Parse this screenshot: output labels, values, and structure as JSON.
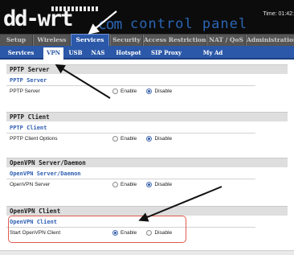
{
  "header": {
    "logo_main": "dd-wrt",
    "logo_com": ".com",
    "logo_tagline": "control panel",
    "time_label": "Time: 01:42:"
  },
  "main_tabs": [
    "Setup",
    "Wireless",
    "Services",
    "Security",
    "Access Restrictions",
    "NAT / QoS",
    "Administration"
  ],
  "active_main_tab": "Services",
  "sub_tabs": [
    "Services",
    "VPN",
    "USB",
    "NAS",
    "Hotspot",
    "SIP Proxy",
    "My Ad Network"
  ],
  "active_sub_tab": "VPN",
  "radio_labels": {
    "enable": "Enable",
    "disable": "Disable"
  },
  "sections": [
    {
      "title": "PPTP Server",
      "subtitle": "PPTP Server",
      "row_label": "PPTP Server",
      "selected": "Disable"
    },
    {
      "title": "PPTP Client",
      "subtitle": "PPTP Client",
      "row_label": "PPTP Client Options",
      "selected": "Disable"
    },
    {
      "title": "OpenVPN Server/Daemon",
      "subtitle": "OpenVPN Server/Daemon",
      "row_label": "OpenVPN Server",
      "selected": "Disable"
    },
    {
      "title": "OpenVPN Client",
      "subtitle": "OpenVPN Client",
      "row_label": "Start OpenVPN Client",
      "selected": "Enable"
    }
  ],
  "colors": {
    "header_bg": "#0c0c0c",
    "nav_blue": "#2b58a8",
    "logo_blue": "#2a65b5",
    "subtitle_blue": "#2f5fb3",
    "highlight_red": "#e05a4e"
  }
}
